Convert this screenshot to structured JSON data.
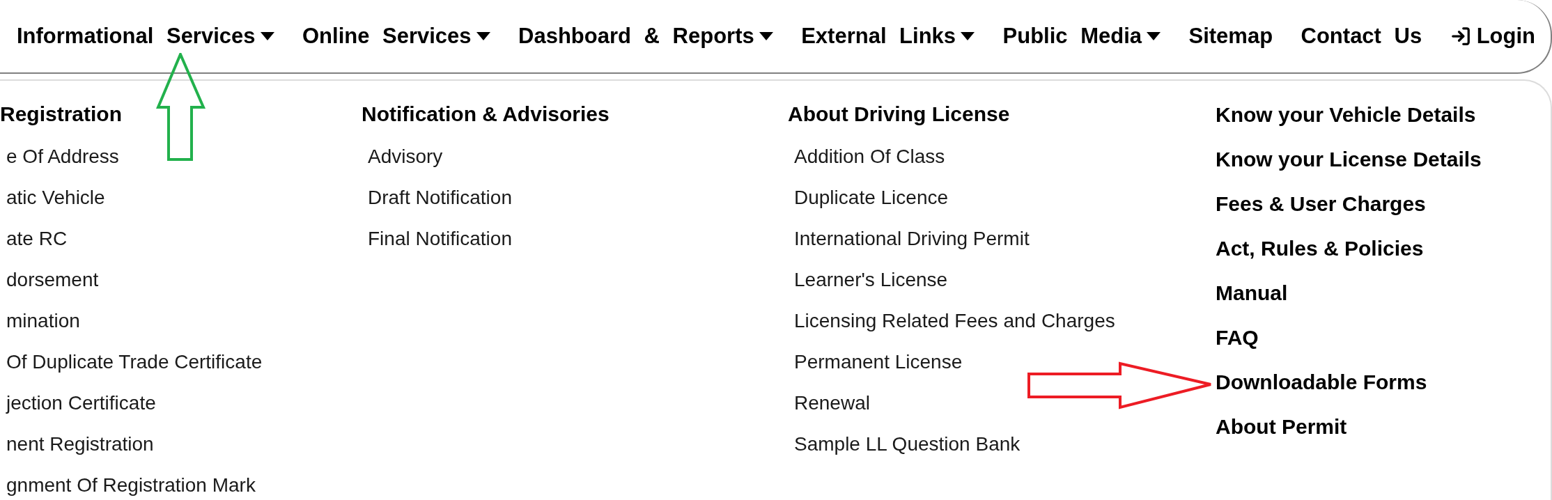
{
  "nav": {
    "items": [
      {
        "label": "Informational Services",
        "kind": "dropdown"
      },
      {
        "label": "Online Services",
        "kind": "dropdown"
      },
      {
        "label": "Dashboard & Reports",
        "kind": "dropdown"
      },
      {
        "label": "External Links",
        "kind": "dropdown"
      },
      {
        "label": "Public Media",
        "kind": "dropdown"
      },
      {
        "label": "Sitemap",
        "kind": "link"
      },
      {
        "label": "Contact Us",
        "kind": "link"
      },
      {
        "label": "Login",
        "kind": "login"
      }
    ]
  },
  "menu_panel": {
    "columns": [
      {
        "kind": "grouped",
        "heading": "Registration",
        "items": [
          "e Of Address",
          "atic Vehicle",
          "ate RC",
          "dorsement",
          "mination",
          "Of Duplicate Trade Certificate",
          "jection Certificate",
          "nent Registration",
          "gnment Of Registration Mark"
        ]
      },
      {
        "kind": "grouped",
        "heading": "Notification & Advisories",
        "items": [
          "Advisory",
          "Draft Notification",
          "Final Notification"
        ]
      },
      {
        "kind": "grouped",
        "heading": "About Driving License",
        "items": [
          "Addition Of Class",
          "Duplicate Licence",
          "International Driving Permit",
          "Learner's License",
          "Licensing Related Fees and Charges",
          "Permanent License",
          "Renewal",
          "Sample LL Question Bank"
        ]
      },
      {
        "kind": "links",
        "items": [
          "Know your Vehicle Details",
          "Know your License Details",
          "Fees & User Charges",
          "Act, Rules & Policies",
          "Manual",
          "FAQ",
          "Downloadable Forms",
          "About Permit"
        ]
      }
    ]
  }
}
